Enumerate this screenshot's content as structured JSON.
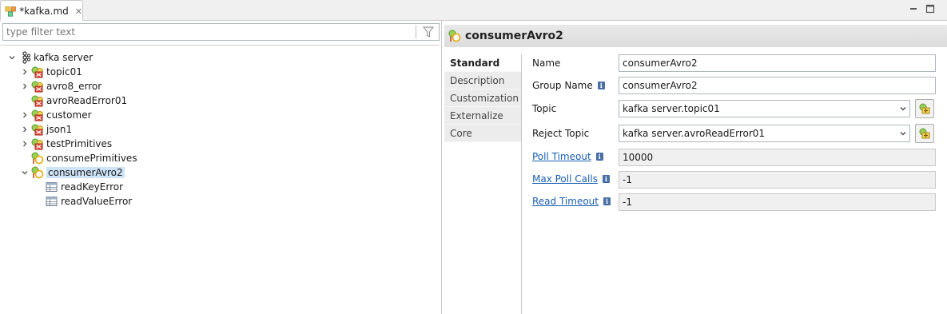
{
  "tab": {
    "title": "*kafka.md",
    "icon": "kafka-model-icon",
    "close_icon": "close-icon"
  },
  "window_controls": {
    "minimize_icon": "minimize-icon",
    "maximize_icon": "maximize-icon"
  },
  "filter": {
    "placeholder": "type filter text",
    "icon": "filter-funnel-icon"
  },
  "tree": {
    "root": {
      "label": "kafka server",
      "icon": "kafka-server-icon",
      "expanded": true
    },
    "items": [
      {
        "label": "topic01",
        "icon": "topic-error-icon",
        "expandable": true
      },
      {
        "label": "avro8_error",
        "icon": "topic-error-icon",
        "expandable": true
      },
      {
        "label": "avroReadError01",
        "icon": "topic-error-icon",
        "expandable": false
      },
      {
        "label": "customer",
        "icon": "topic-error-icon",
        "expandable": true
      },
      {
        "label": "json1",
        "icon": "topic-error-icon",
        "expandable": true
      },
      {
        "label": "testPrimitives",
        "icon": "topic-error-icon",
        "expandable": true
      },
      {
        "label": "consumePrimitives",
        "icon": "consumer-icon",
        "expandable": false
      },
      {
        "label": "consumerAvro2",
        "icon": "consumer-icon",
        "expandable": true,
        "expanded": true,
        "selected": true
      }
    ],
    "children": [
      {
        "label": "readKeyError",
        "icon": "table-icon"
      },
      {
        "label": "readValueError",
        "icon": "table-icon"
      }
    ]
  },
  "detail": {
    "title": "consumerAvro2",
    "title_icon": "consumer-icon",
    "tabs": [
      "Standard",
      "Description",
      "Customization",
      "Externalize",
      "Core"
    ],
    "active_tab": "Standard",
    "fields": {
      "name": {
        "label": "Name",
        "value": "consumerAvro2"
      },
      "group_name": {
        "label": "Group Name",
        "value": "consumerAvro2"
      },
      "topic": {
        "label": "Topic",
        "value": "kafka server.topic01"
      },
      "reject_topic": {
        "label": "Reject Topic",
        "value": "kafka server.avroReadError01"
      },
      "poll_timeout": {
        "label": "Poll Timeout",
        "value": "10000"
      },
      "max_poll_calls": {
        "label": "Max Poll Calls",
        "value": "-1"
      },
      "read_timeout": {
        "label": "Read Timeout",
        "value": "-1"
      }
    },
    "info_icon": "info-icon",
    "picker_icon": "object-picker-icon"
  }
}
